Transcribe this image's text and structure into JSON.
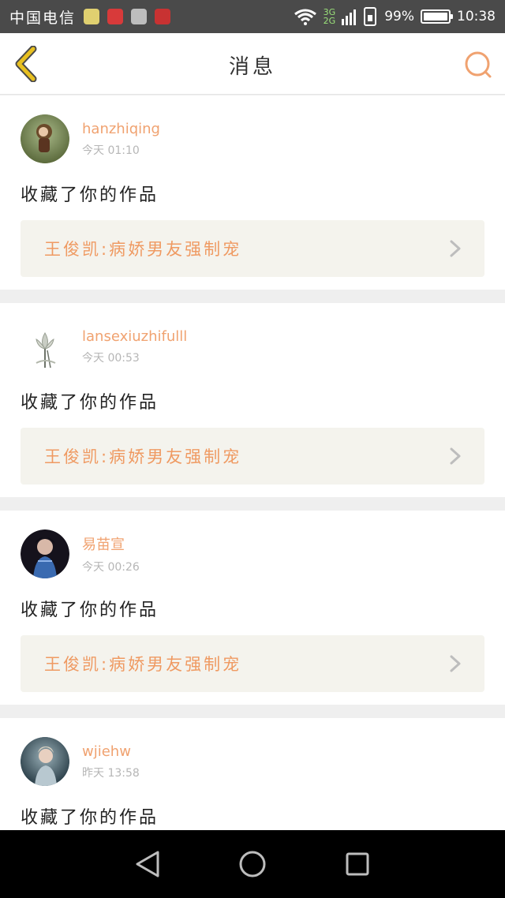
{
  "status_bar": {
    "carrier": "中国电信",
    "net_top": "3G",
    "net_bottom": "2G",
    "battery": "99%",
    "battery_level": 0.99,
    "time": "10:38"
  },
  "header": {
    "title": "消息"
  },
  "colors": {
    "accent": "#f0a270",
    "back_arrow": "#e8c020",
    "card_link_bg": "#f4f3ed"
  },
  "messages": [
    {
      "username": "hanzhiqing",
      "time": "今天 01:10",
      "action": "收藏了你的作品",
      "work_title": "王俊凯:病娇男友强制宠"
    },
    {
      "username": "lansexiuzhifulll",
      "time": "今天 00:53",
      "action": "收藏了你的作品",
      "work_title": "王俊凯:病娇男友强制宠"
    },
    {
      "username": "易苗宣",
      "time": "今天 00:26",
      "action": "收藏了你的作品",
      "work_title": "王俊凯:病娇男友强制宠"
    },
    {
      "username": "wjiehw",
      "time": "昨天 13:58",
      "action": "收藏了你的作品",
      "work_title": ""
    }
  ]
}
